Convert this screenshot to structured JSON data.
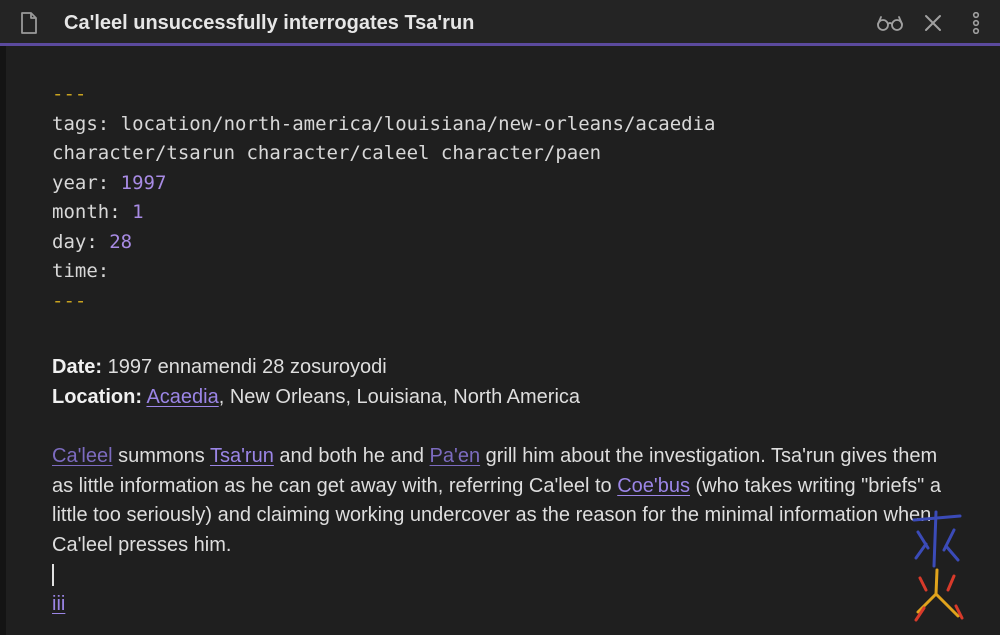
{
  "header": {
    "title": "Ca'leel unsuccessfully interrogates Tsa'run",
    "icons": [
      "document-icon",
      "reading-view-icon",
      "close-icon",
      "more-options-icon"
    ]
  },
  "frontmatter": {
    "dashes_open": "---",
    "tags_key": "tags:",
    "tags_value": "location/north-america/louisiana/new-orleans/acaedia",
    "tags_cont": "character/tsarun character/caleel character/paen",
    "year_key": "year:",
    "year_value": "1997",
    "month_key": "month:",
    "month_value": "1",
    "day_key": "day:",
    "day_value": "28",
    "time_key": "time:",
    "dashes_close": "---"
  },
  "meta": {
    "date_label": "Date:",
    "date_value": "1997 ennamendi 28 zosuroyodi",
    "location_label": "Location:",
    "location_link": "Acaedia",
    "location_rest": ", New Orleans, Louisiana, North America"
  },
  "paragraph": {
    "link1": "Ca'leel",
    "text1": " summons ",
    "link2": "Tsa'run",
    "text2": " and both he and ",
    "link3": "Pa'en",
    "text3": " grill him about the investigation.  Tsa'run gives them as little information as he can get away with, referring Ca'leel to ",
    "link4": "Coe'bus",
    "text4": " (who takes writing \"briefs\" a little too seriously) and claiming working undercover as the reason for the minimal information when Ca'leel presses him."
  },
  "footer_link": "iii",
  "colors": {
    "background": "#1f1f1f",
    "accent": "#5b4a9e",
    "link": "#9b85e6",
    "frontmatter_dash": "#c9a31f",
    "frontmatter_number": "#a88be4"
  }
}
